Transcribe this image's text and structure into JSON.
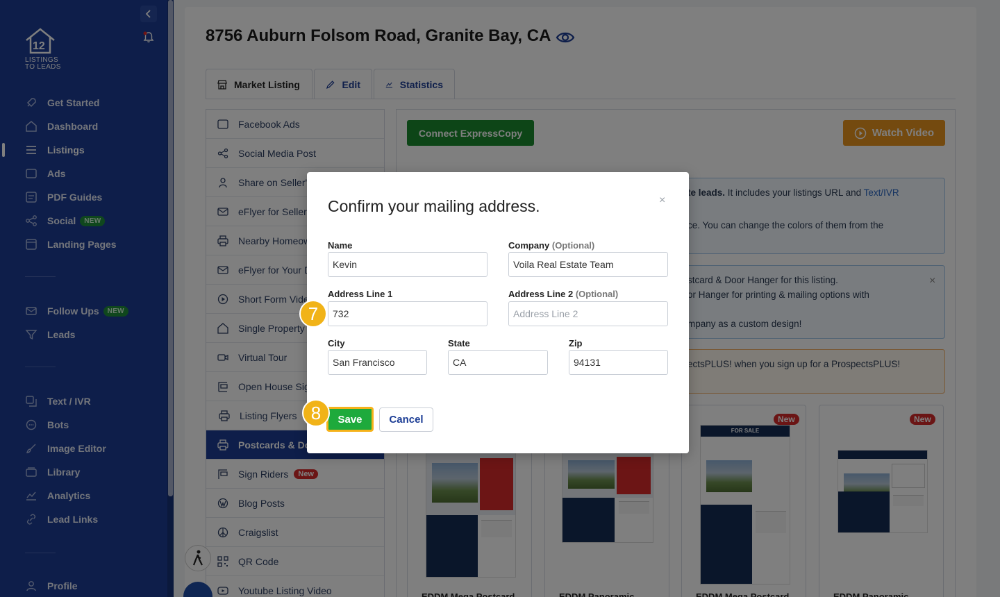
{
  "sidebar": {
    "logo_text_line1": "LISTINGS",
    "logo_text_line2": "TO LEADS",
    "items": [
      {
        "label": "Get Started",
        "icon": "rocket-icon"
      },
      {
        "label": "Dashboard",
        "icon": "home-icon"
      },
      {
        "label": "Listings",
        "icon": "list-icon",
        "active": true
      },
      {
        "label": "Ads",
        "icon": "ad-icon"
      },
      {
        "label": "PDF Guides",
        "icon": "pdf-icon"
      },
      {
        "label": "Social",
        "icon": "share-icon",
        "badge": "NEW"
      },
      {
        "label": "Landing Pages",
        "icon": "page-icon"
      },
      {
        "label": "Follow Ups",
        "icon": "mail-icon",
        "badge": "NEW"
      },
      {
        "label": "Leads",
        "icon": "filter-icon"
      },
      {
        "label": "Text / IVR",
        "icon": "phone-icon"
      },
      {
        "label": "Bots",
        "icon": "chat-icon"
      },
      {
        "label": "Image Editor",
        "icon": "brush-icon"
      },
      {
        "label": "Library",
        "icon": "folder-icon"
      },
      {
        "label": "Analytics",
        "icon": "chart-icon"
      },
      {
        "label": "Lead Links",
        "icon": "link-icon"
      },
      {
        "label": "Profile",
        "icon": "user-icon"
      }
    ]
  },
  "header": {
    "title": "8756 Auburn Folsom Road, Granite Bay, CA"
  },
  "tabs": [
    {
      "label": "Market Listing"
    },
    {
      "label": "Edit"
    },
    {
      "label": "Statistics"
    }
  ],
  "left_menu": [
    {
      "label": "Facebook Ads"
    },
    {
      "label": "Social Media Post"
    },
    {
      "label": "Share on Seller's"
    },
    {
      "label": "eFlyer for Seller's"
    },
    {
      "label": "Nearby Homeowners"
    },
    {
      "label": "eFlyer for Your D"
    },
    {
      "label": "Short Form Video"
    },
    {
      "label": "Single Property"
    },
    {
      "label": "Virtual Tour"
    },
    {
      "label": "Open House Sign"
    },
    {
      "label": "Listing Flyers"
    },
    {
      "label": "Postcards & Do"
    },
    {
      "label": "Sign Riders",
      "badge": "New"
    },
    {
      "label": "Blog Posts"
    },
    {
      "label": "Craigslist"
    },
    {
      "label": "QR Code"
    },
    {
      "label": "Youtube Listing Video"
    }
  ],
  "content": {
    "connect_btn": "Connect ExpressCopy",
    "watch_btn": "Watch Video",
    "info1_bold": "te leads.",
    "info1_rest": " It includes your listings URL and ",
    "info1_link": "Text/IVR",
    "info1_line2": "ce. You can change the colors of them from the",
    "info2_line1": "stcard & Door Hanger for this listing.",
    "info2_line2": "or Hanger for printing & mailing options with",
    "info2_line3": "mpany as a custom design!",
    "info3_line1": "ectsPLUS! when you sign up for a ProspectsPLUS!",
    "cards": [
      {
        "footer": "EDDM Mega Postcard",
        "badge": ""
      },
      {
        "footer": "EDDM Panoramic",
        "badge": ""
      },
      {
        "footer": "EDDM Mega Postcard",
        "badge": "New"
      },
      {
        "footer": "EDDM Panoramic",
        "badge": "New"
      }
    ],
    "card_top_text": "FOR SALE"
  },
  "modal": {
    "title": "Confirm your mailing address.",
    "close": "×",
    "name_label": "Name",
    "name_value": "Kevin",
    "company_label": "Company",
    "company_optional": "(Optional)",
    "company_value": "Voila Real Estate Team",
    "addr1_label": "Address Line 1",
    "addr1_value": "732",
    "addr2_label": "Address Line 2",
    "addr2_optional": "(Optional)",
    "addr2_placeholder": "Address Line 2",
    "city_label": "City",
    "city_value": "San Francisco",
    "state_label": "State",
    "state_value": "CA",
    "zip_label": "Zip",
    "zip_value": "94131",
    "save_label": "Save",
    "cancel_label": "Cancel"
  },
  "steps": {
    "step7": "7",
    "step8": "8"
  },
  "colors": {
    "sidebar_bg": "#1c3d95",
    "primary_green": "#1a8b2e",
    "accent_orange": "#e8951f",
    "step_badge": "#f1b318"
  }
}
